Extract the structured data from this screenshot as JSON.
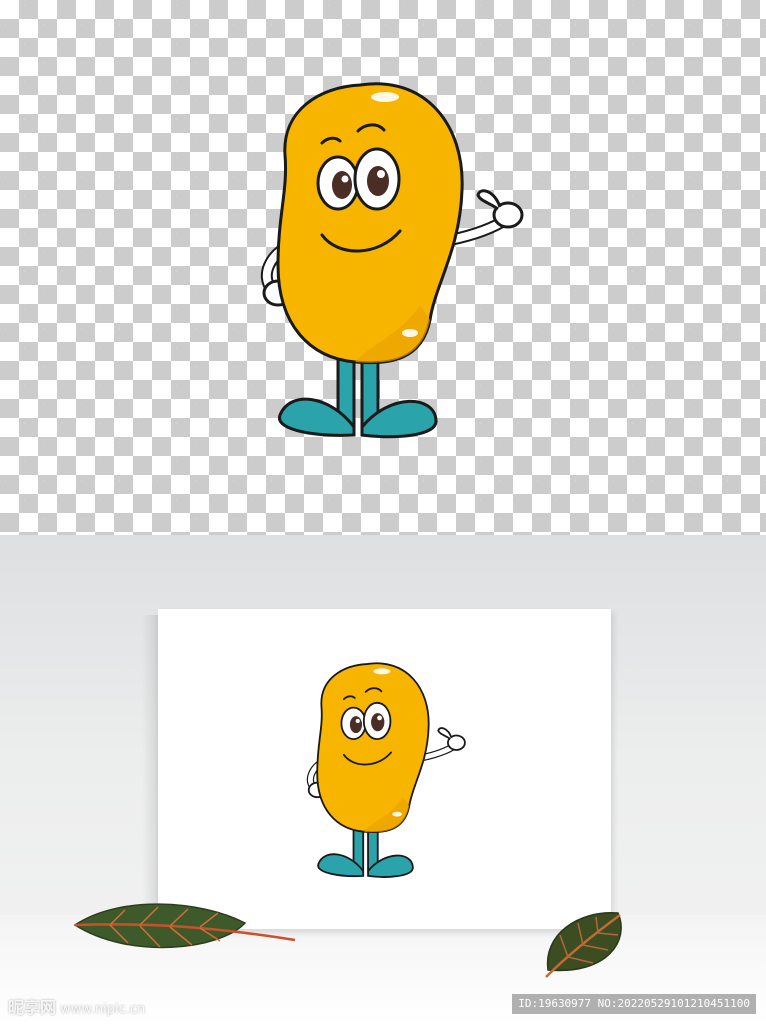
{
  "image": {
    "top_panel": "transparent-checkerboard",
    "bottom_panel": "canvas-mockup-on-floor"
  },
  "colors": {
    "body": "#f7b500",
    "body_shadow": "#e9a300",
    "shoes": "#2aa3ab",
    "outline": "#1a1a1a",
    "glove": "#ffffff"
  },
  "watermark": {
    "logo": "昵享网",
    "url": "www.nipic.cn"
  },
  "image_id": "ID:19630977 NO:20220529101210451100"
}
